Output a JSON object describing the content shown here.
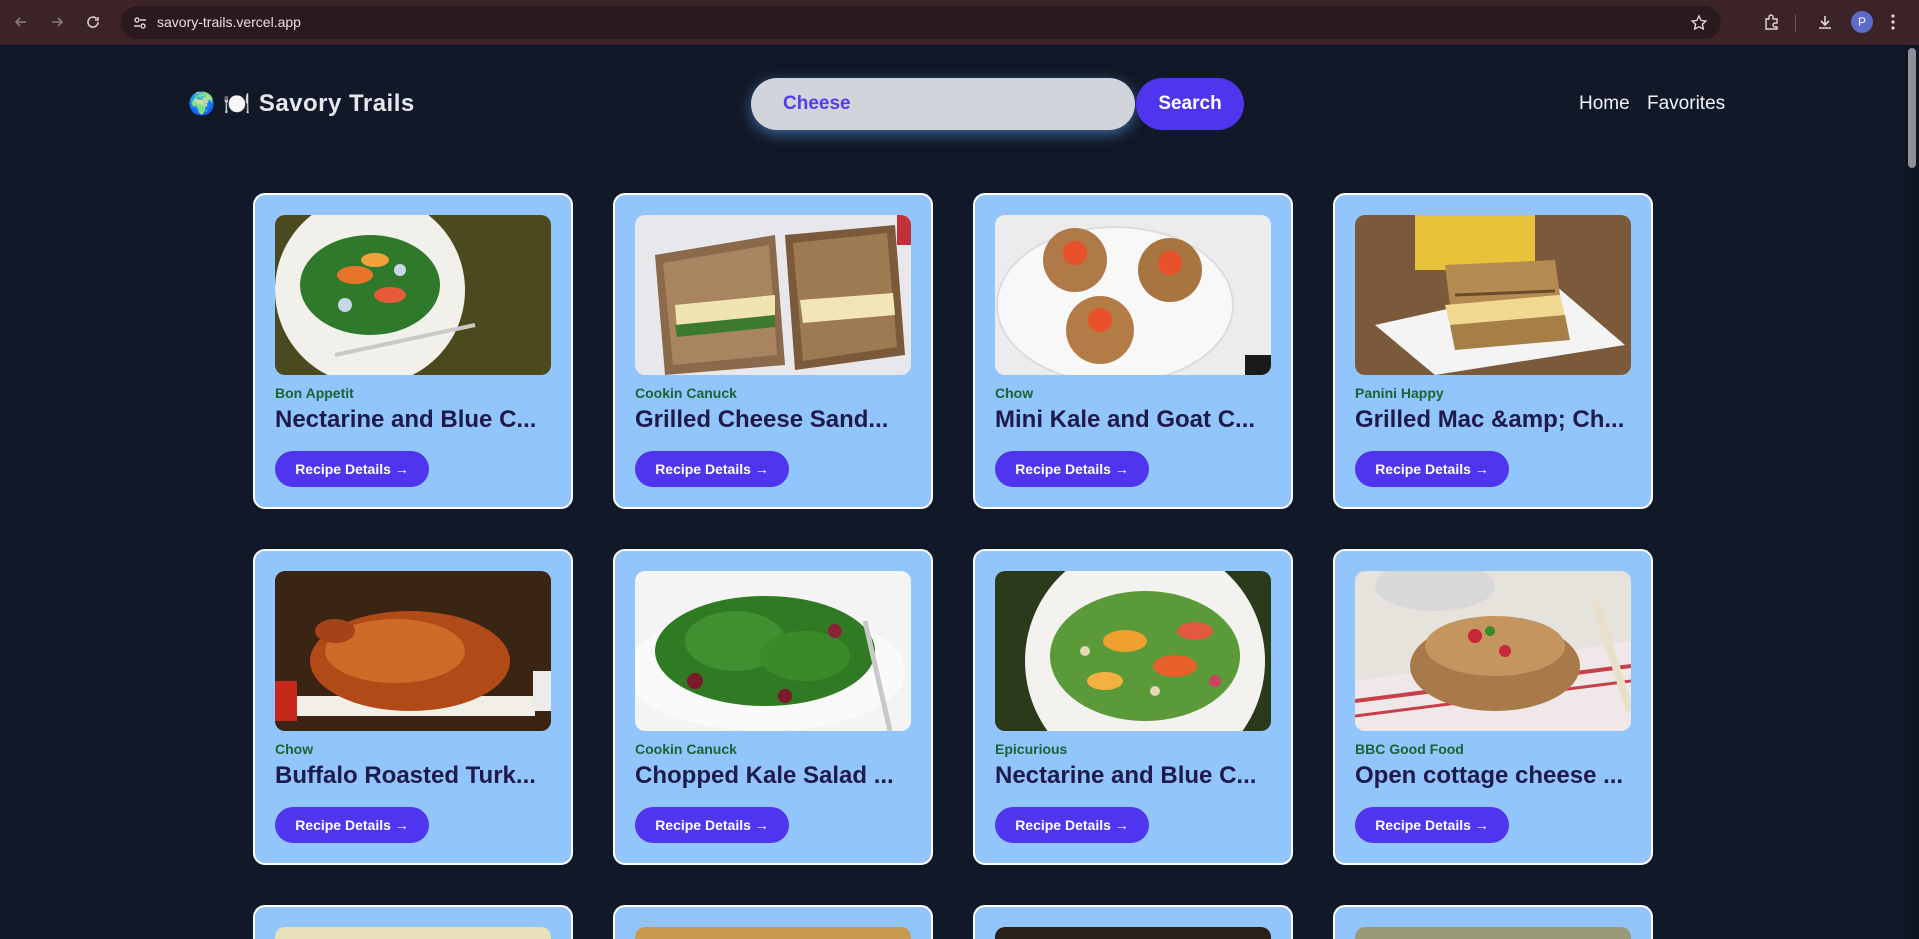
{
  "browser": {
    "url": "savory-trails.vercel.app",
    "profile_initial": "P"
  },
  "header": {
    "logo_emoji_1": "🌍",
    "logo_emoji_2": "🍽️",
    "logo_text": "Savory Trails",
    "search_value": "Cheese",
    "search_button": "Search",
    "nav": [
      {
        "label": "Home"
      },
      {
        "label": "Favorites"
      }
    ]
  },
  "cards": [
    {
      "source": "Bon Appetit",
      "title": "Nectarine and Blue C...",
      "button": "Recipe Details →",
      "image": "salad-plate"
    },
    {
      "source": "Cookin Canuck",
      "title": "Grilled Cheese Sand...",
      "button": "Recipe Details →",
      "image": "grilled-sandwich"
    },
    {
      "source": "Chow",
      "title": "Mini Kale and Goat C...",
      "button": "Recipe Details →",
      "image": "mini-cakes"
    },
    {
      "source": "Panini Happy",
      "title": "Grilled Mac &amp; Ch...",
      "button": "Recipe Details →",
      "image": "panini"
    },
    {
      "source": "Chow",
      "title": "Buffalo Roasted Turk...",
      "button": "Recipe Details →",
      "image": "roast-turkey"
    },
    {
      "source": "Cookin Canuck",
      "title": "Chopped Kale Salad ...",
      "button": "Recipe Details →",
      "image": "kale-salad"
    },
    {
      "source": "Epicurious",
      "title": "Nectarine and Blue C...",
      "button": "Recipe Details →",
      "image": "nectarine-salad"
    },
    {
      "source": "BBC Good Food",
      "title": "Open cottage cheese ...",
      "button": "Recipe Details →",
      "image": "open-toast"
    }
  ],
  "colors": {
    "background": "#111827",
    "card": "#93c5fd",
    "accent": "#4f36ee",
    "source_text": "#166534",
    "title_text": "#1e1b4b"
  }
}
